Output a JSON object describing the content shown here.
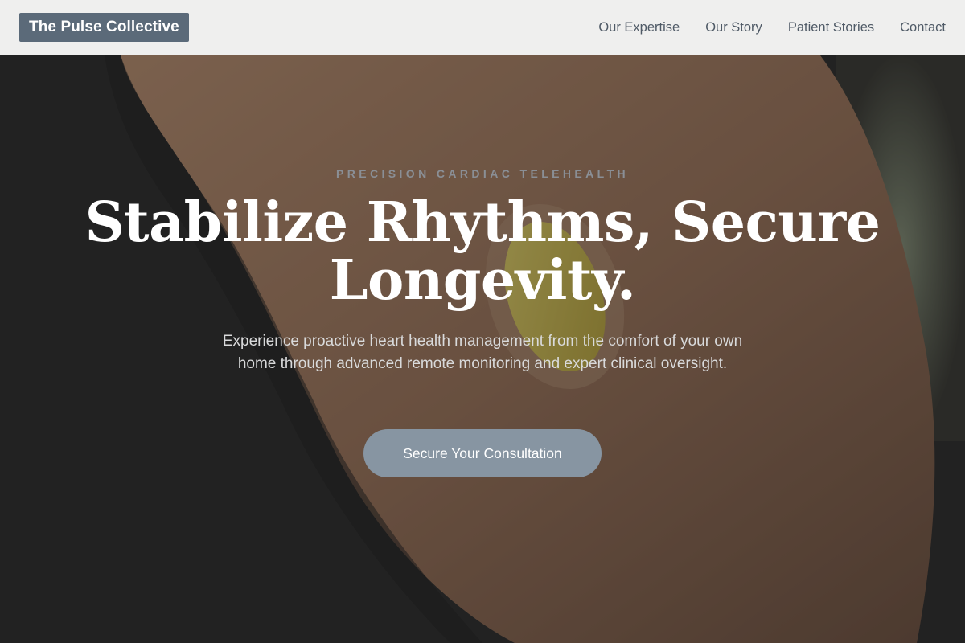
{
  "header": {
    "brand": "The Pulse Collective",
    "nav": [
      {
        "label": "Our Expertise"
      },
      {
        "label": "Our Story"
      },
      {
        "label": "Patient Stories"
      },
      {
        "label": "Contact"
      }
    ]
  },
  "hero": {
    "eyebrow": "PRECISION CARDIAC TELEHEALTH",
    "headline_line1": "Stabilize Rhythms, Secure",
    "headline_line2": "Longevity.",
    "subtitle": "Experience proactive heart health management from the comfort of your own home through advanced remote monitoring and expert clinical oversight.",
    "cta_label": "Secure Your Consultation"
  },
  "colors": {
    "header_bg": "#efefee",
    "brand_bg": "#5b6a79",
    "nav_text": "#4f5a66",
    "cta_bg": "#8795a2",
    "eyebrow_text": "#8a8f96"
  }
}
